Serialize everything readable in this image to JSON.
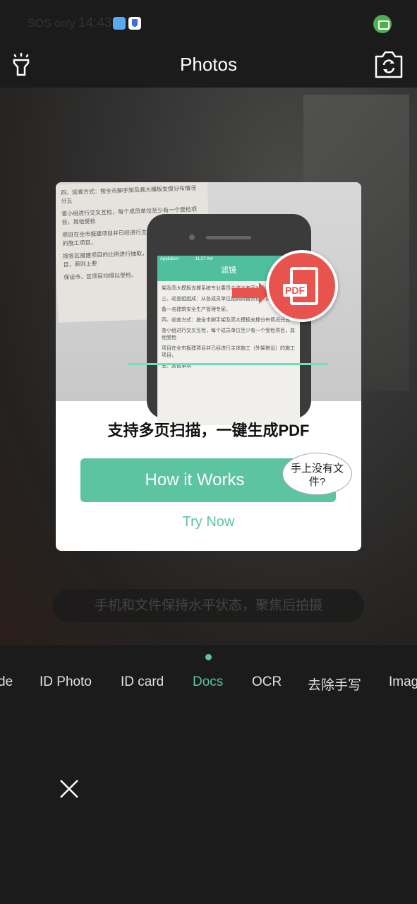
{
  "status_bar": {
    "carrier": "SOS only",
    "time": "14:43"
  },
  "header": {
    "title": "Photos",
    "left_icon": "flashlight-icon",
    "right_icon": "switch-camera-icon"
  },
  "viewfinder": {
    "hint": "手机和文件保持水平状态，聚焦后拍摄"
  },
  "promo_modal": {
    "illustration": {
      "phone_title": "滤镜",
      "phone_status_carrier": "Applidium",
      "phone_status_time": "11:27 AM",
      "badge": "PDF",
      "doc_lines": [
        "架及高大模板支撑系统专业委员会选派专家对检查项目",
        "三、巡查组组成：从各成员单位抽调具备资格人员，",
        "备一名建筑安全生产管理专家。",
        "四、巡查方式：按全市脚手架及高大模板支撑分布情况分五",
        "查小组进行交叉互检，每个成员单位至少有一个受检项目，其他受检",
        "项目在全市报建项目并已经进行主体施工（外架搭设）的施工项目，",
        "按各区报建项目的比例进行抽取，总量不低于50个项目，原则上要",
        "保证市、区项目均得以受检。",
        "五、其他事项"
      ]
    },
    "title": "支持多页扫描，一键生成PDF",
    "primary_button": "How it Works",
    "bubble": "手上没有文件?",
    "secondary_link": "Try Now"
  },
  "modes": {
    "items": [
      "de",
      "ID Photo",
      "ID card",
      "Docs",
      "OCR",
      "去除手写",
      "Imag"
    ],
    "active": "Docs"
  },
  "colors": {
    "accent": "#5cc4a0",
    "pdf_red": "#e8534d",
    "background": "#1b1b1b"
  }
}
